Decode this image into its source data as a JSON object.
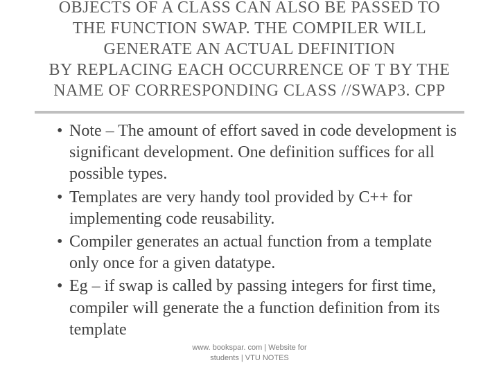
{
  "title": {
    "line1": "OBJECTS OF A CLASS CAN ALSO BE PASSED TO",
    "line2": "THE FUNCTION SWAP. THE COMPILER WILL",
    "line3": "GENERATE AN ACTUAL DEFINITION",
    "line4": "BY REPLACING EACH OCCURRENCE OF T BY THE",
    "line5": "NAME OF CORRESPONDING CLASS //SWAP3. CPP"
  },
  "bullets": [
    "Note – The amount of effort saved in code development is significant development. One definition suffices for all possible types.",
    "Templates are very handy tool provided by C++ for implementing code reusability.",
    "Compiler generates an actual function from a template only once for a given datatype.",
    "Eg – if swap is called by passing integers for first time, compiler will generate the a function definition from its template"
  ],
  "footer": {
    "line1": "www. bookspar. com | Website for",
    "line2": "students | VTU NOTES"
  },
  "dot": "•"
}
